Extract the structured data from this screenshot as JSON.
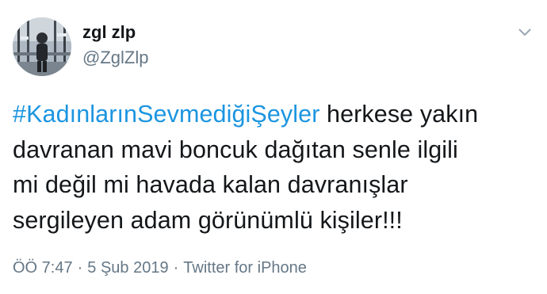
{
  "tweet": {
    "author": {
      "display_name": "zgl zlp",
      "handle": "@ZglZlp"
    },
    "text": {
      "hashtag": "#KadınlarınSevmediğiŞeyler",
      "line1_rest": " herkese yakın",
      "line2": "davranan mavi boncuk dağıtan senle ilgili",
      "line3": "mi değil mi havada kalan davranışlar",
      "line4": "sergileyen adam görünümlü kişiler!!!"
    },
    "meta": {
      "time": "ÖÖ 7:47",
      "separator": "·",
      "date": "5 Şub 2019",
      "source": "Twitter for iPhone"
    }
  },
  "colors": {
    "link": "#1b95e0",
    "text": "#14171a",
    "muted": "#657786"
  },
  "icons": {
    "menu": "chevron-down-icon"
  }
}
